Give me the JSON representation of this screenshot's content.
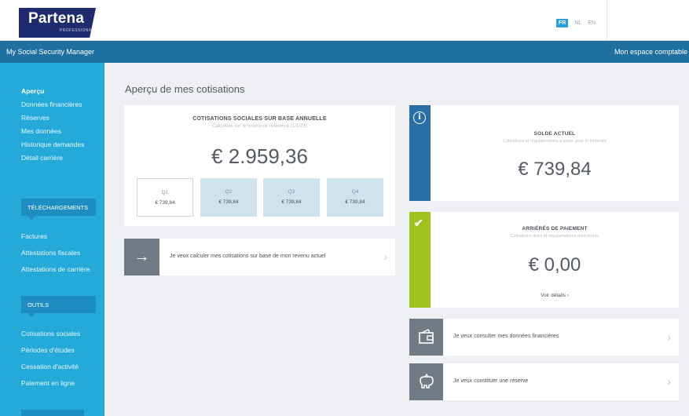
{
  "header": {
    "logo_name": "Partena",
    "logo_sub": "PROFESSIONAL",
    "languages": [
      "FR",
      "NL",
      "EN"
    ],
    "active_language": "FR"
  },
  "navbar": {
    "app_title": "My Social Security Manager",
    "account_link": "Mon espace comptable"
  },
  "sidebar": {
    "links_top": [
      "Aperçu",
      "Données financières",
      "Réserves",
      "Mes données",
      "Historique demandes",
      "Détail carrière"
    ],
    "section_downloads": "TÉLÉCHARGEMENTS",
    "links_downloads": [
      "Factures",
      "Attestations fiscales",
      "Attestations de carrière"
    ],
    "section_tools": "OUTILS",
    "links_tools": [
      "Cotisations sociales",
      "Périodes d'études",
      "Cessation d'activité",
      "Paiement en ligne"
    ]
  },
  "main": {
    "page_title": "Aperçu de mes cotisations",
    "annual": {
      "title": "COTISATIONS SOCIALES SUR BASE ANNUELLE",
      "subtitle": "Calculées sur le revenu de référence (1/1/23)",
      "total": "€ 2.959,36",
      "quarters": [
        {
          "label": "Q1",
          "amount": "€ 739,84"
        },
        {
          "label": "Q2",
          "amount": "€ 739,84"
        },
        {
          "label": "Q3",
          "amount": "€ 739,84"
        },
        {
          "label": "Q4",
          "amount": "€ 739,84"
        }
      ]
    },
    "calc_row": {
      "text": "Je veux calculer mes cotisations sur base de mon revenu actuel",
      "icon": "arrow-right-icon"
    },
    "balance": {
      "title": "SOLDE ACTUEL",
      "subtitle": "Cotisations et régularisations à payer pour le trimestre",
      "amount": "€ 739,84",
      "icon": "info-icon",
      "icon_glyph": "i",
      "color": "#2a6ea6"
    },
    "arrears": {
      "title": "ARRIÉRÉS DE PAIEMENT",
      "subtitle": "Cotisations dues et régularisations antérieures",
      "amount": "€ 0,00",
      "link": "Voir détails ›",
      "icon": "check-icon",
      "icon_glyph": "✔",
      "color": "#9fc31c"
    },
    "link_rows": [
      {
        "text": "Je veux consulter mes données financières",
        "icon": "wallet-icon"
      },
      {
        "text": "Je veux constituer une réserve",
        "icon": "piggy-bank-icon"
      }
    ],
    "chevron": "›",
    "arrow_glyph": "→"
  },
  "colors": {
    "brand_navy": "#1e2b6e",
    "navbar_blue": "#1f6fa0",
    "sidebar_blue": "#25a9d9",
    "quarter_bg": "#cfe3ee"
  }
}
